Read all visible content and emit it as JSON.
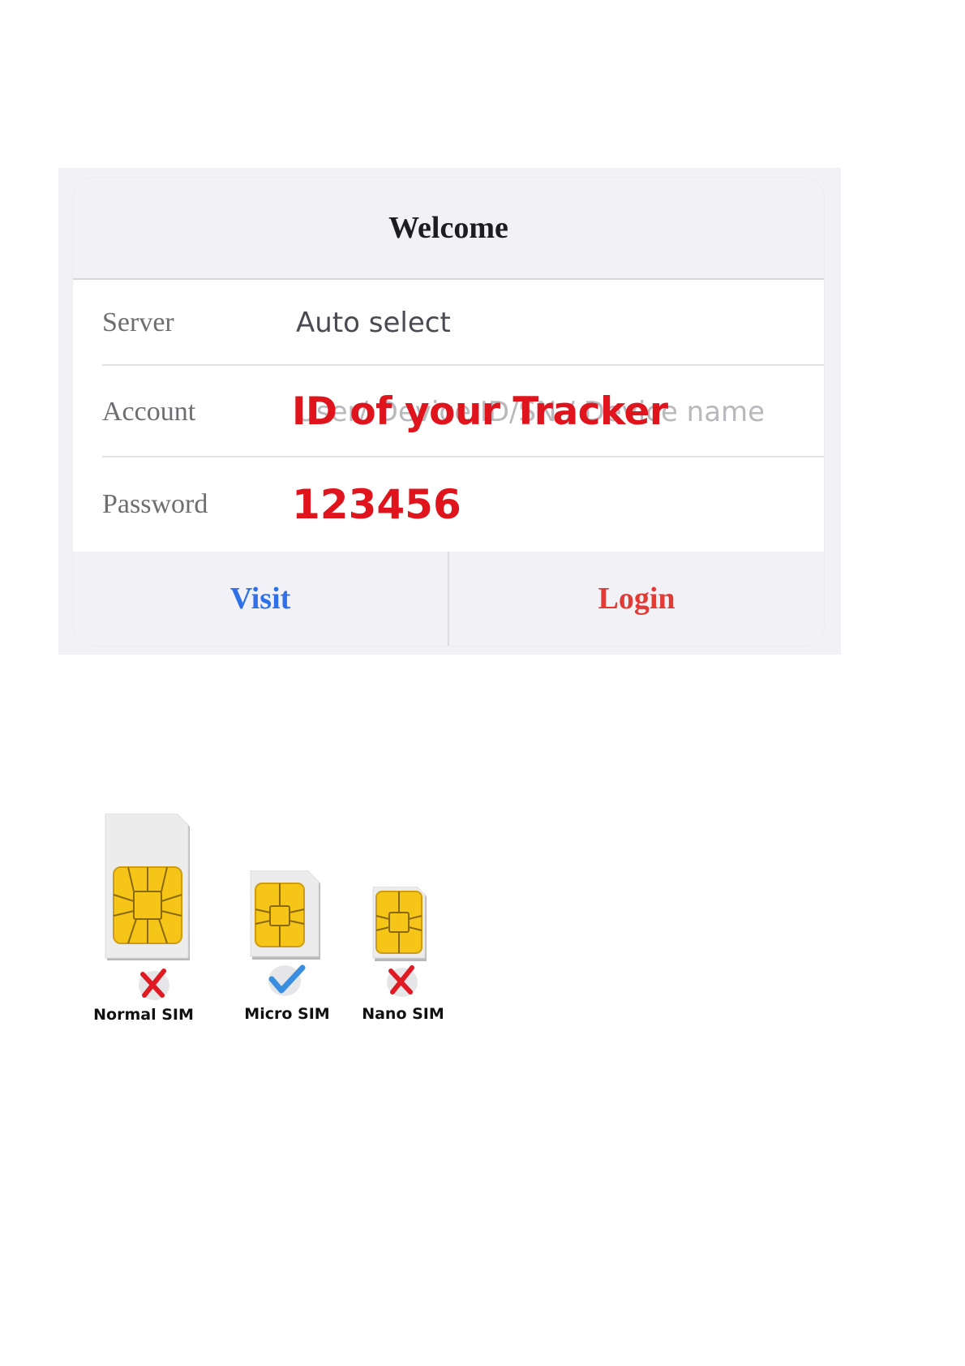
{
  "dialog": {
    "title": "Welcome",
    "server": {
      "label": "Server",
      "value": "Auto select"
    },
    "account": {
      "label": "Account",
      "placeholder": "User/ Device ID/SN / Device name",
      "overlay": "ID of your Tracker"
    },
    "password": {
      "label": "Password",
      "overlay": "123456"
    },
    "buttons": {
      "visit": "Visit",
      "login": "Login"
    }
  },
  "sim_cards": [
    {
      "label": "Normal SIM",
      "status": "cross-icon",
      "supported": false
    },
    {
      "label": "Micro SIM",
      "status": "check-icon",
      "supported": true
    },
    {
      "label": "Nano SIM",
      "status": "cross-icon",
      "supported": false
    }
  ],
  "colors": {
    "visit": "#2f6fe8",
    "login": "#e23a34",
    "annotation": "#e0141c",
    "chip": "#f5c518"
  }
}
